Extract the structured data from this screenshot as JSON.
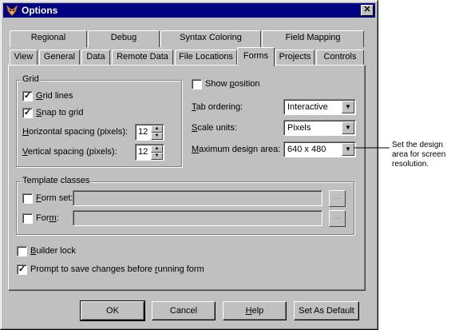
{
  "window": {
    "title": "Options",
    "close_glyph": "✕",
    "icon": "fox-app-icon"
  },
  "tabs_top": [
    "Regional",
    "Debug",
    "Syntax Coloring",
    "Field Mapping"
  ],
  "tabs_bottom": [
    "View",
    "General",
    "Data",
    "Remote Data",
    "File Locations",
    "Forms",
    "Projects",
    "Controls"
  ],
  "active_tab": "Forms",
  "grid": {
    "label": "Grid",
    "grid_lines": {
      "prefix": "",
      "accel": "G",
      "rest": "rid lines",
      "checked": true
    },
    "snap_to_grid": {
      "prefix": "",
      "accel": "S",
      "rest": "nap to grid",
      "checked": true
    },
    "horizontal": {
      "prefix": "",
      "accel": "H",
      "rest": "orizontal spacing (pixels):",
      "value": "12"
    },
    "vertical": {
      "prefix": "",
      "accel": "V",
      "rest": "ertical spacing (pixels):",
      "value": "12"
    }
  },
  "show_position": {
    "prefix": "Show ",
    "accel": "p",
    "rest": "osition",
    "checked": false
  },
  "tab_ordering": {
    "prefix": "",
    "accel": "T",
    "rest": "ab ordering:",
    "value": "Interactive"
  },
  "scale_units": {
    "prefix": "",
    "accel": "S",
    "rest": "cale units:",
    "value": "Pixels"
  },
  "max_design_area": {
    "prefix": "",
    "accel": "M",
    "rest": "aximum design area:",
    "value": "640 x 480"
  },
  "template_classes": {
    "label": "Template classes",
    "form_set": {
      "prefix": "",
      "accel": "F",
      "rest": "orm set:",
      "checked": false,
      "browse": "..."
    },
    "form": {
      "prefix": "For",
      "accel": "m",
      "rest": ":",
      "checked": false,
      "browse": "..."
    }
  },
  "builder_lock": {
    "prefix": "",
    "accel": "B",
    "rest": "uilder lock",
    "checked": false
  },
  "prompt_save": {
    "prefix": "Prompt to save changes before ",
    "accel": "r",
    "rest": "unning form",
    "checked": true
  },
  "buttons": {
    "ok": "OK",
    "cancel": "Cancel",
    "help": {
      "prefix": "",
      "accel": "H",
      "rest": "elp"
    },
    "set_default": "Set As Default"
  },
  "callout": {
    "line1": "Set the design",
    "line2": "area for screen",
    "line3": "resolution."
  },
  "colors": {
    "title_bar": "#000080",
    "face": "#c0c0c0"
  }
}
